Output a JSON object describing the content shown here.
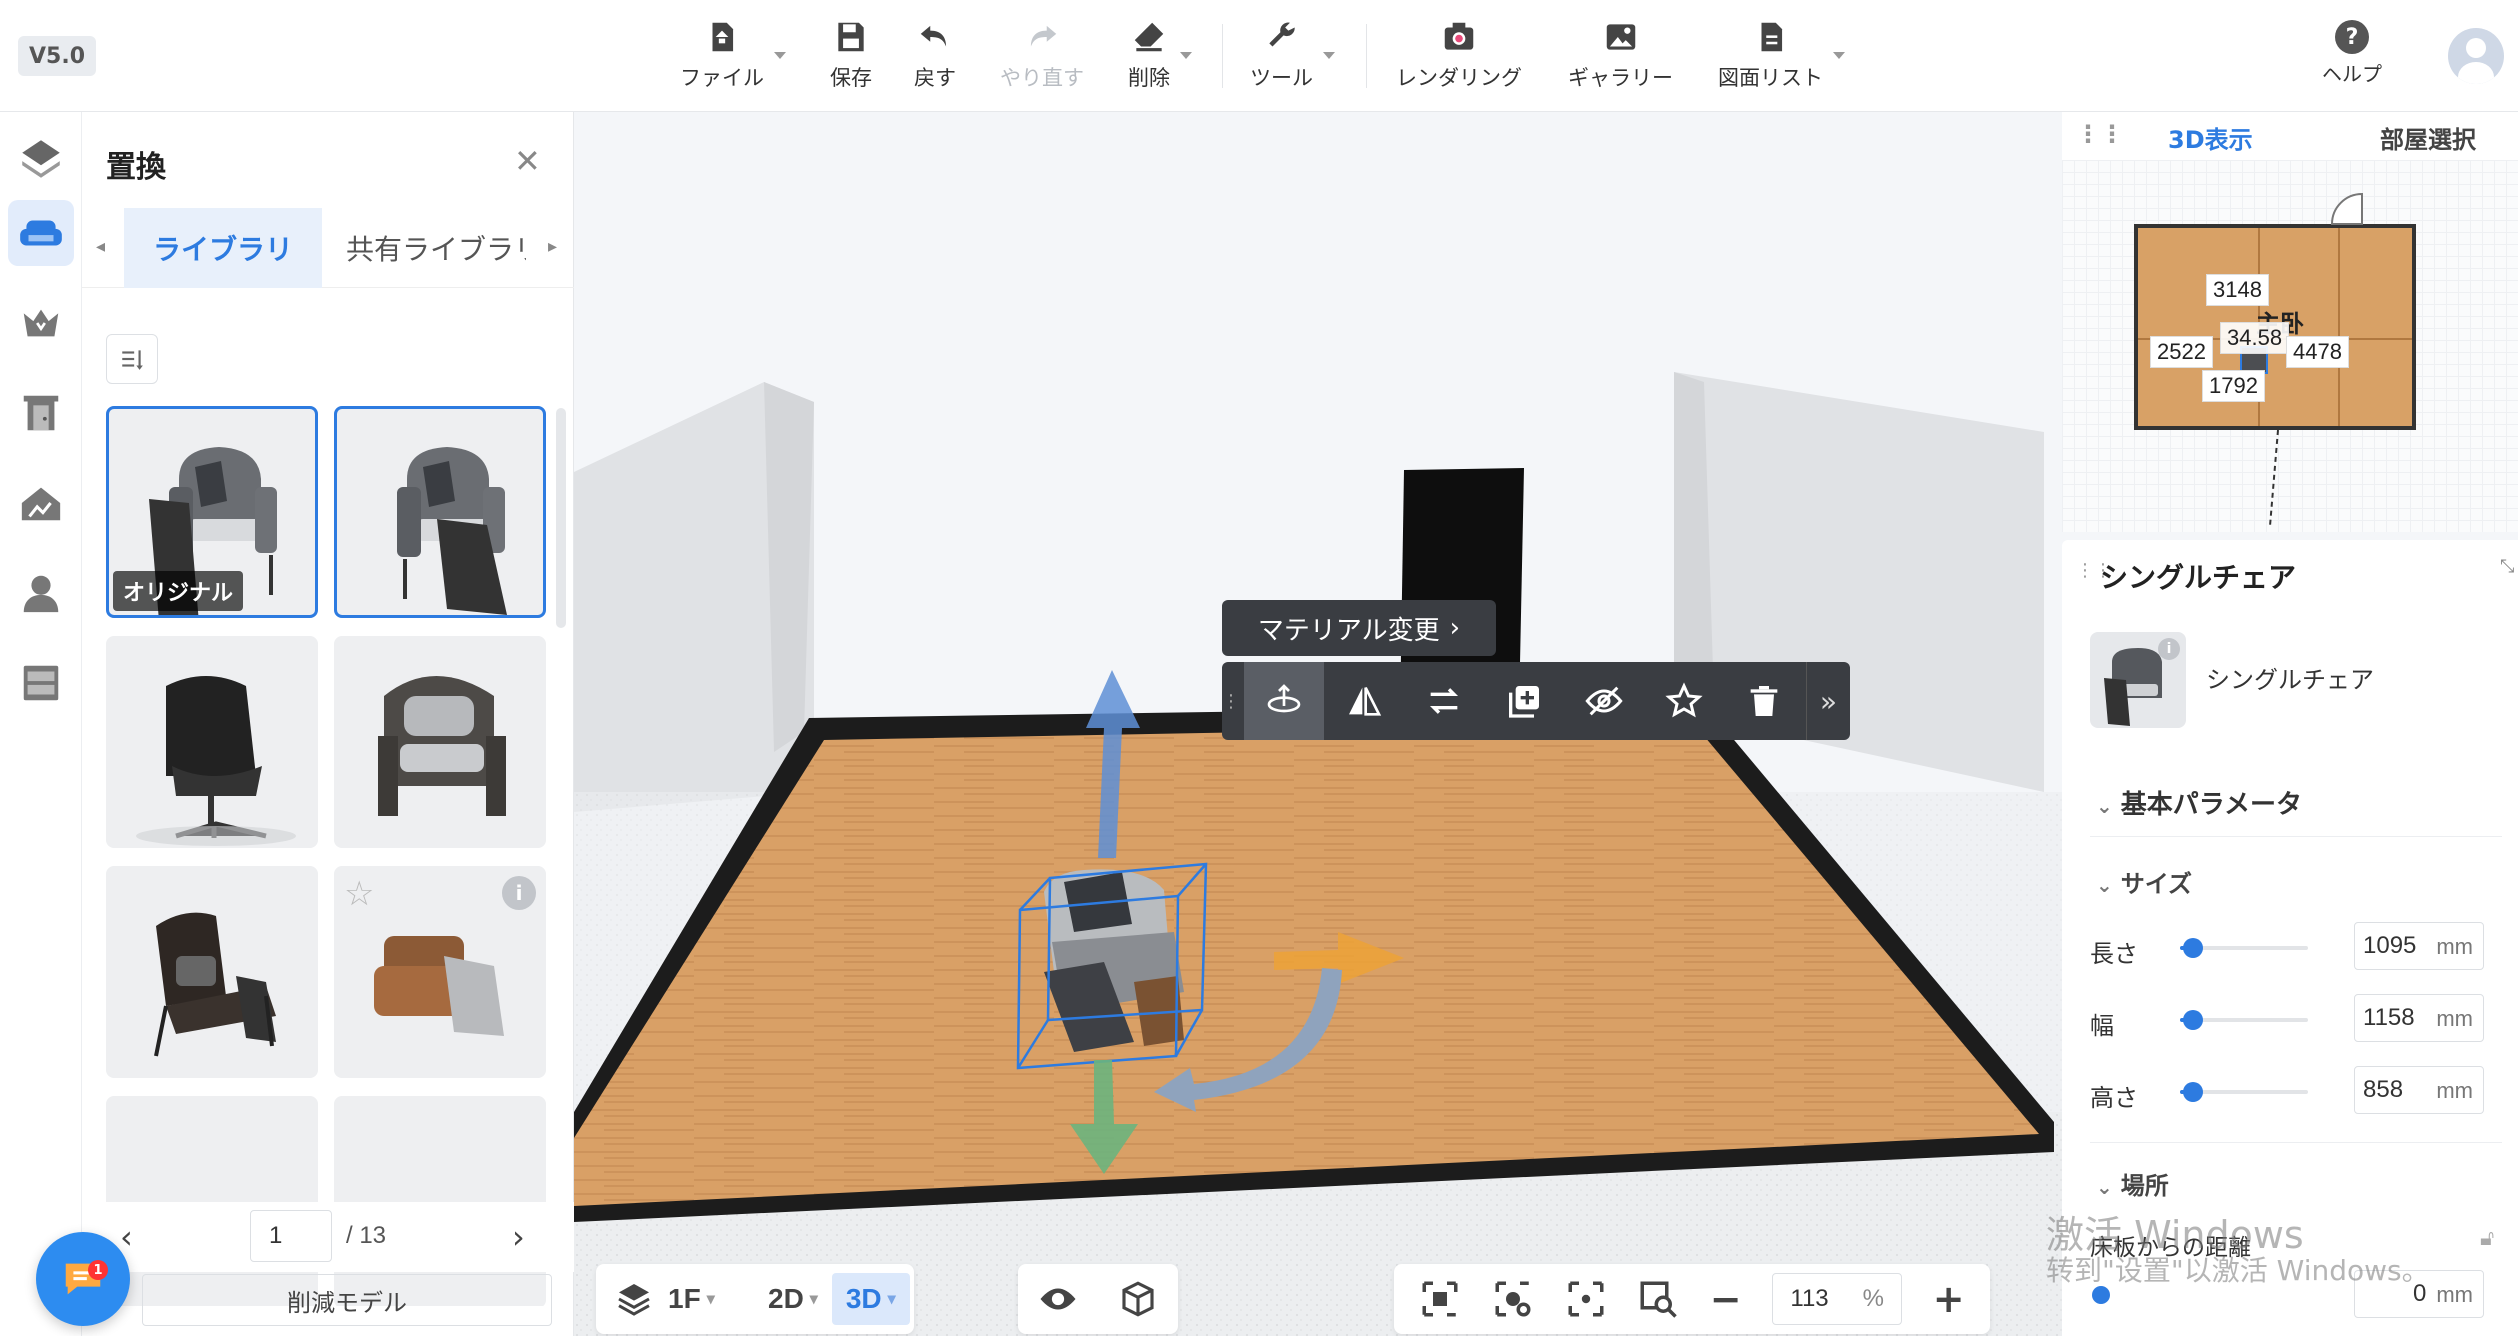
{
  "app": {
    "version": "V5.0"
  },
  "toolbar": {
    "file": "ファイル",
    "save": "保存",
    "undo": "戻す",
    "redo": "やり直す",
    "delete": "削除",
    "tools": "ツール",
    "rendering": "レンダリング",
    "gallery": "ギャラリー",
    "drawing_list": "図面リスト",
    "help": "ヘルプ"
  },
  "library": {
    "title": "置換",
    "tabs": [
      "ライブラリ",
      "共有ライブラリ"
    ],
    "items": [
      {
        "label": "オリジナル",
        "selected": false
      },
      {
        "label": "",
        "selected": true
      },
      {
        "label": "",
        "selected": false
      },
      {
        "label": "",
        "selected": false
      },
      {
        "label": "",
        "selected": false
      },
      {
        "label": "",
        "selected": false
      }
    ],
    "page": "1",
    "page_total": "/ 13",
    "reduce_button": "削減モデル",
    "chat_badge": "1"
  },
  "object_menu": {
    "material_change": "マテリアル変更"
  },
  "view_bar": {
    "floor": "1F",
    "mode_2d": "2D",
    "mode_3d": "3D",
    "zoom_value": "113",
    "zoom_unit": "%"
  },
  "right_panel": {
    "tab_3d": "3D表示",
    "tab_room": "部屋選択",
    "minimap": {
      "room_label": "主卧",
      "dims": {
        "top": "3148",
        "center": "34.58",
        "left": "2522",
        "right": "4478",
        "bottom": "1792"
      }
    },
    "props": {
      "title": "シングルチェア",
      "item_name": "シングルチェア",
      "section_basic": "基本パラメータ",
      "section_size": "サイズ",
      "params": [
        {
          "label": "長さ",
          "value": "1095",
          "unit": "mm",
          "level": 0.1
        },
        {
          "label": "幅",
          "value": "1158",
          "unit": "mm",
          "level": 0.1
        },
        {
          "label": "高さ",
          "value": "858",
          "unit": "mm",
          "level": 0.1
        }
      ],
      "section_location": "場所",
      "floor_distance_label": "床板からの距離",
      "floor_distance_value": "0",
      "floor_distance_unit": "mm"
    }
  },
  "watermark": {
    "line1": "激活 Windows",
    "line2": "转到\"设置\"以激活 Windows。"
  },
  "colors": {
    "accent": "#2d7be0",
    "floor": "#d9a066"
  }
}
